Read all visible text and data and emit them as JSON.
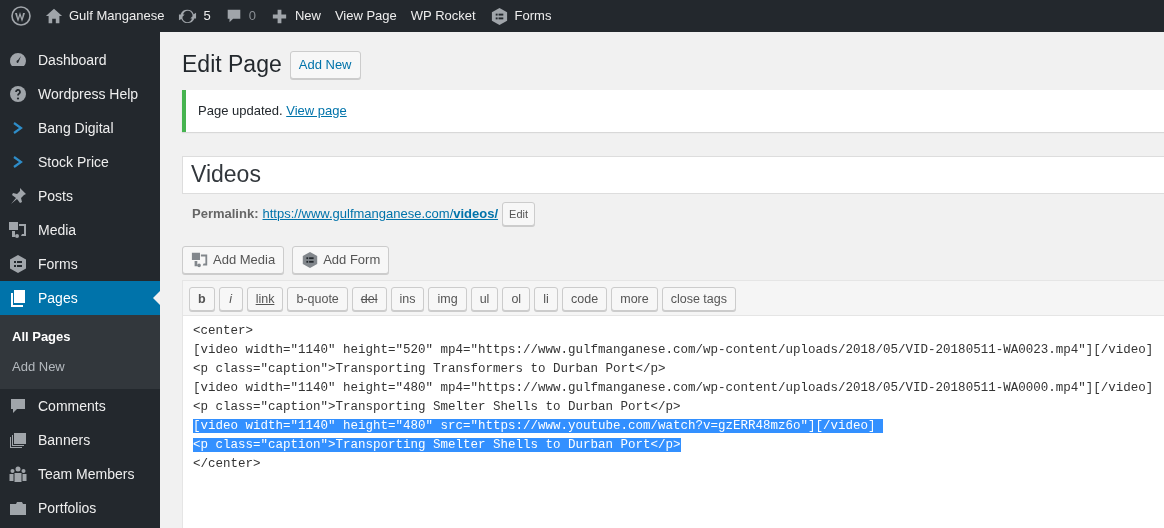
{
  "admin_bar": {
    "site": "Gulf Manganese",
    "updates": "5",
    "comments": "0",
    "items": [
      "New",
      "View Page",
      "WP Rocket",
      "Forms"
    ]
  },
  "sidebar": {
    "items": [
      {
        "label": "Dashboard",
        "selected": false
      },
      {
        "label": "Wordpress Help",
        "selected": false
      },
      {
        "label": "Bang Digital",
        "selected": false
      },
      {
        "label": "Stock Price",
        "selected": false
      },
      {
        "label": "Posts",
        "selected": false
      },
      {
        "label": "Media",
        "selected": false
      },
      {
        "label": "Forms",
        "selected": false
      },
      {
        "label": "Pages",
        "selected": true,
        "children": [
          {
            "label": "All Pages",
            "selected": true
          },
          {
            "label": "Add New",
            "selected": false
          }
        ]
      },
      {
        "label": "Comments",
        "selected": false
      },
      {
        "label": "Banners",
        "selected": false
      },
      {
        "label": "Team Members",
        "selected": false
      },
      {
        "label": "Portfolios",
        "selected": false
      }
    ]
  },
  "heading": "Edit Page",
  "add_new": "Add New",
  "notice": {
    "text": "Page updated.",
    "link": "View page"
  },
  "title_field": {
    "value": "Videos"
  },
  "permalink": {
    "label": "Permalink:",
    "url": "https://www.gulfmanganese.com/**videos/**",
    "edit": "Edit"
  },
  "media_buttons": [
    "Add Media",
    "Add Form"
  ],
  "quicktags": [
    {
      "label": "b",
      "kind": "bold"
    },
    {
      "label": "i",
      "kind": "italic"
    },
    {
      "label": "link",
      "kind": "link"
    },
    {
      "label": "b-quote",
      "kind": "plain"
    },
    {
      "label": "del",
      "kind": "del"
    },
    {
      "label": "ins",
      "kind": "plain"
    },
    {
      "label": "img",
      "kind": "plain"
    },
    {
      "label": "ul",
      "kind": "plain"
    },
    {
      "label": "ol",
      "kind": "plain"
    },
    {
      "label": "li",
      "kind": "plain"
    },
    {
      "label": "code",
      "kind": "plain"
    },
    {
      "label": "more",
      "kind": "plain"
    },
    {
      "label": "close tags",
      "kind": "plain"
    }
  ],
  "editor_lines": [
    {
      "text": "<center>",
      "selected": false
    },
    {
      "text": "[video width=\"1140\" height=\"520\" mp4=\"https://www.gulfmanganese.com/wp-content/uploads/2018/05/VID-20180511-WA0023.mp4\"][/video]",
      "selected": false
    },
    {
      "text": "<p class=\"caption\">Transporting Transformers to Durban Port</p>",
      "selected": false
    },
    {
      "text": "[video width=\"1140\" height=\"480\" mp4=\"https://www.gulfmanganese.com/wp-content/uploads/2018/05/VID-20180511-WA0000.mp4\"][/video]",
      "selected": false
    },
    {
      "text": "<p class=\"caption\">Transporting Smelter Shells to Durban Port</p>",
      "selected": false
    },
    {
      "text": "[video width=\"1140\" height=\"480\" src=\"https://www.youtube.com/watch?v=gzERR48mz6o\"][/video] ",
      "selected": true
    },
    {
      "text": "<p class=\"caption\">Transporting Smelter Shells to Durban Port</p>",
      "selected": true
    },
    {
      "text": "</center>",
      "selected": false
    }
  ]
}
